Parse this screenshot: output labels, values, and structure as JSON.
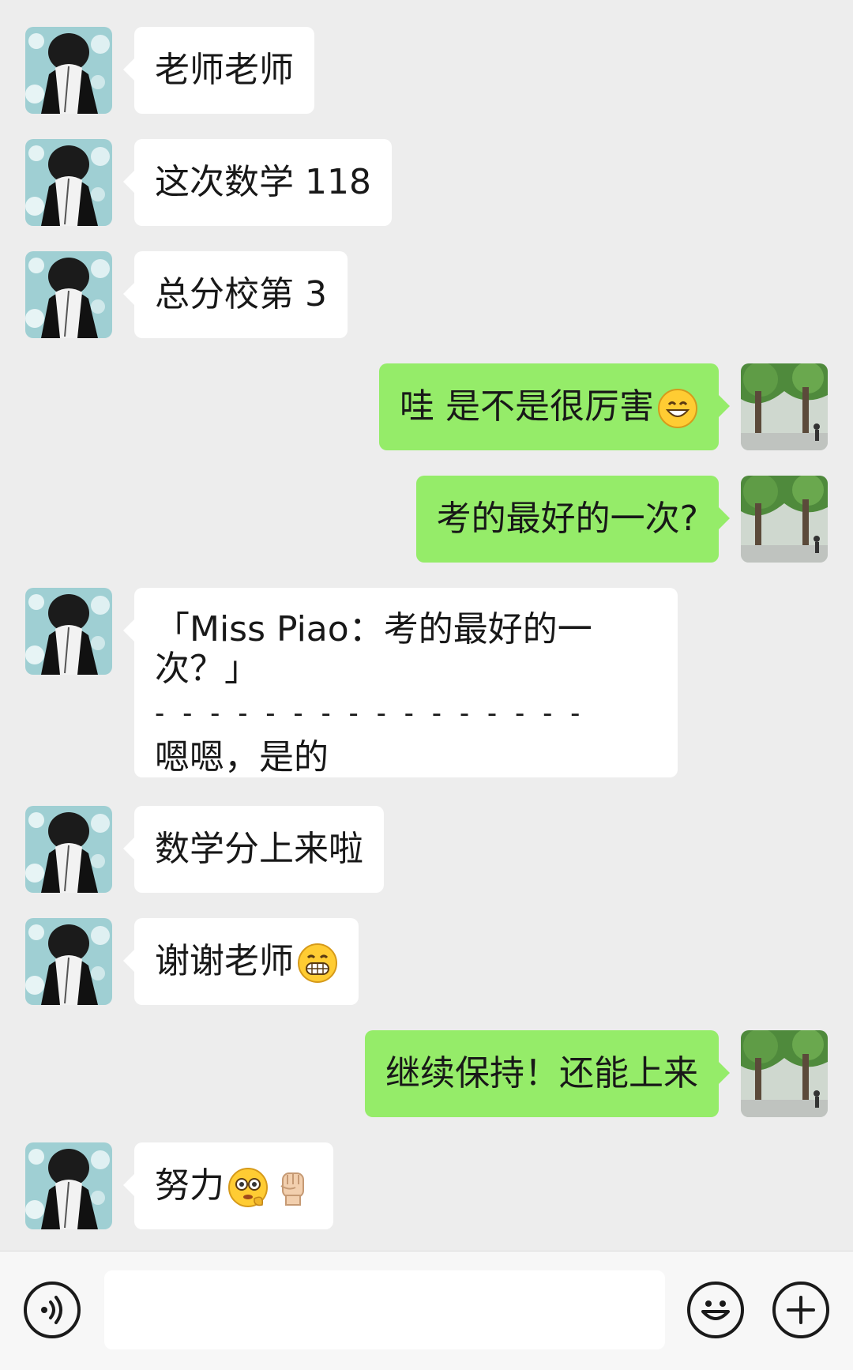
{
  "messages": [
    {
      "side": "left",
      "text": "老师老师"
    },
    {
      "side": "left",
      "text": "这次数学 118"
    },
    {
      "side": "left",
      "text": "总分校第 3"
    },
    {
      "side": "right",
      "text": "哇 是不是很厉害",
      "emoji": "grinning-face-emoji"
    },
    {
      "side": "right",
      "text": "考的最好的一次?"
    },
    {
      "side": "left",
      "quote": "「Miss Piao：考的最好的一次？」",
      "divider": "- - - - - - - - - - - - - - - -",
      "text": "嗯嗯，是的"
    },
    {
      "side": "left",
      "text": "数学分上来啦"
    },
    {
      "side": "left",
      "text": "谢谢老师",
      "emoji": "grin-teeth-emoji"
    },
    {
      "side": "right",
      "text": "继续保持！还能上来"
    },
    {
      "side": "left",
      "text": "努力",
      "emoji": "fighting-face-emoji",
      "emoji2": "raised-fist-emoji"
    }
  ],
  "input_bar": {
    "voice_icon": "voice-wave-icon",
    "emoji_icon": "smiley-icon",
    "plus_icon": "plus-icon",
    "value": "",
    "placeholder": ""
  },
  "colors": {
    "background": "#ededed",
    "sent_bubble": "#95ec69",
    "received_bubble": "#ffffff"
  }
}
